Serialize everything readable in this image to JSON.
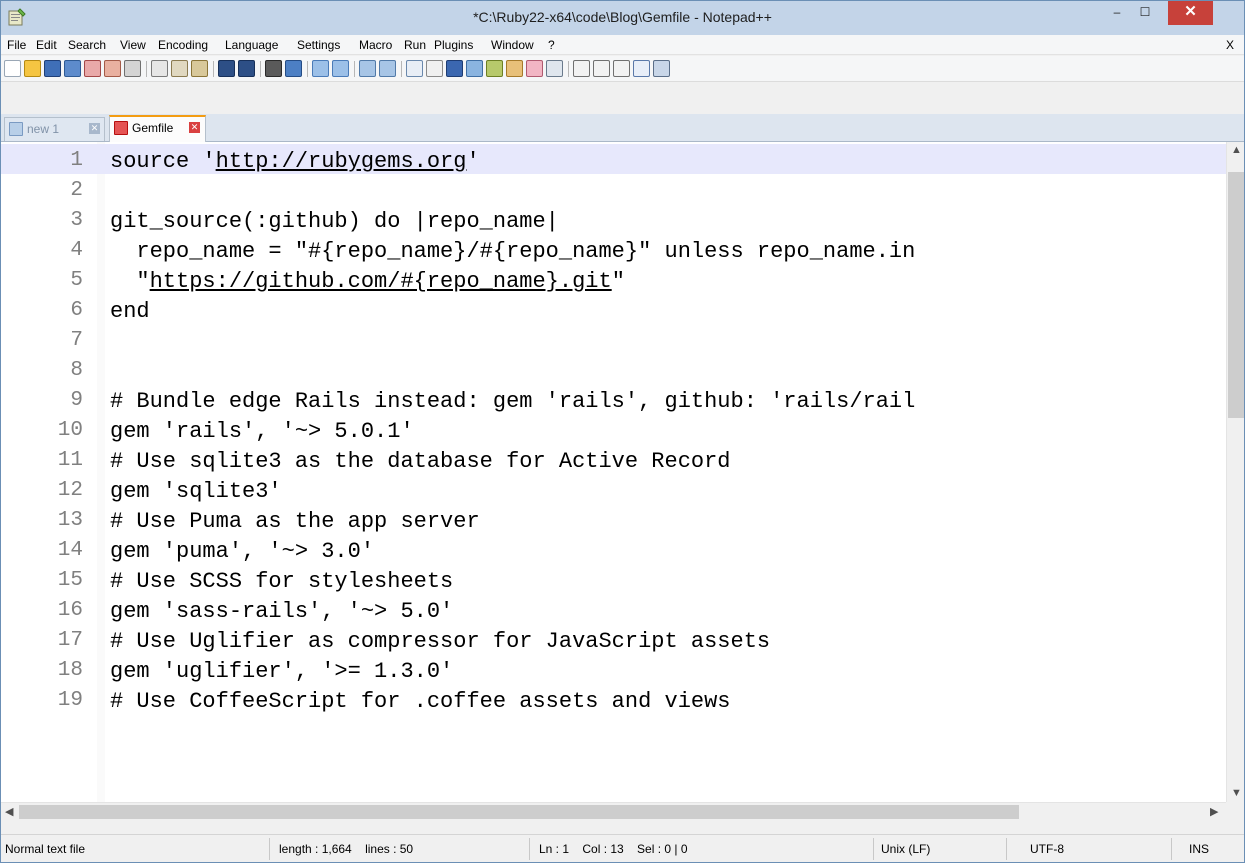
{
  "window": {
    "title": "*C:\\Ruby22-x64\\code\\Blog\\Gemfile - Notepad++",
    "minimize_label": "–",
    "maximize_label": "☐",
    "close_label": "✕"
  },
  "menu": {
    "items": [
      "File",
      "Edit",
      "Search",
      "View",
      "Encoding",
      "Language",
      "Settings",
      "Macro",
      "Run",
      "Plugins",
      "Window",
      "?"
    ],
    "close_label": "X"
  },
  "tabs": [
    {
      "label": "new 1",
      "active": false
    },
    {
      "label": "Gemfile",
      "active": true
    }
  ],
  "editor": {
    "lines": [
      {
        "n": "1",
        "parts": [
          [
            "text",
            "source '"
          ],
          [
            "link",
            "http://rubygems.org"
          ],
          [
            "text",
            "'"
          ]
        ]
      },
      {
        "n": "2",
        "parts": [
          [
            "text",
            ""
          ]
        ]
      },
      {
        "n": "3",
        "parts": [
          [
            "text",
            "git_source(:github) do |repo_name|"
          ]
        ]
      },
      {
        "n": "4",
        "parts": [
          [
            "text",
            "  repo_name = \"#{repo_name}/#{repo_name}\" unless repo_name.in"
          ]
        ]
      },
      {
        "n": "5",
        "parts": [
          [
            "text",
            "  \""
          ],
          [
            "link",
            "https://github.com/#{repo_name}.git"
          ],
          [
            "text",
            "\""
          ]
        ]
      },
      {
        "n": "6",
        "parts": [
          [
            "text",
            "end"
          ]
        ]
      },
      {
        "n": "7",
        "parts": [
          [
            "text",
            ""
          ]
        ]
      },
      {
        "n": "8",
        "parts": [
          [
            "text",
            ""
          ]
        ]
      },
      {
        "n": "9",
        "parts": [
          [
            "text",
            "# Bundle edge Rails instead: gem 'rails', github: 'rails/rail"
          ]
        ]
      },
      {
        "n": "10",
        "parts": [
          [
            "text",
            "gem 'rails', '~> 5.0.1'"
          ]
        ]
      },
      {
        "n": "11",
        "parts": [
          [
            "text",
            "# Use sqlite3 as the database for Active Record"
          ]
        ]
      },
      {
        "n": "12",
        "parts": [
          [
            "text",
            "gem 'sqlite3'"
          ]
        ]
      },
      {
        "n": "13",
        "parts": [
          [
            "text",
            "# Use Puma as the app server"
          ]
        ]
      },
      {
        "n": "14",
        "parts": [
          [
            "text",
            "gem 'puma', '~> 3.0'"
          ]
        ]
      },
      {
        "n": "15",
        "parts": [
          [
            "text",
            "# Use SCSS for stylesheets"
          ]
        ]
      },
      {
        "n": "16",
        "parts": [
          [
            "text",
            "gem 'sass-rails', '~> 5.0'"
          ]
        ]
      },
      {
        "n": "17",
        "parts": [
          [
            "text",
            "# Use Uglifier as compressor for JavaScript assets"
          ]
        ]
      },
      {
        "n": "18",
        "parts": [
          [
            "text",
            "gem 'uglifier', '>= 1.3.0'"
          ]
        ]
      },
      {
        "n": "19",
        "parts": [
          [
            "text",
            "# Use CoffeeScript for .coffee assets and views"
          ]
        ]
      }
    ],
    "current_line": 1
  },
  "status": {
    "file_type": "Normal text file",
    "length_lines": "length : 1,664    lines : 50",
    "position": "Ln : 1    Col : 13    Sel : 0 | 0",
    "eol": "Unix (LF)",
    "encoding": "UTF-8",
    "mode": "INS"
  },
  "colors": {
    "title_bar": "#c3d4e8",
    "close_button": "#c7413a",
    "current_line": "#e7e8fc",
    "line_number": "#808080",
    "active_tab_accent": "#f39c12"
  },
  "toolbar_icons": [
    "new-file-icon",
    "open-file-icon",
    "save-icon",
    "save-all-icon",
    "close-icon",
    "close-all-icon",
    "print-icon",
    "cut-icon",
    "copy-icon",
    "paste-icon",
    "undo-icon",
    "redo-icon",
    "find-icon",
    "replace-icon",
    "zoom-in-icon",
    "zoom-out-icon",
    "sync-vertical-icon",
    "sync-horizontal-icon",
    "word-wrap-icon",
    "show-all-chars-icon",
    "indent-guide-icon",
    "document-map-icon",
    "function-list-icon",
    "folder-workspace-icon",
    "doc-list-icon",
    "monitor-icon",
    "record-macro-icon",
    "stop-macro-icon",
    "play-macro-icon",
    "run-macro-multiple-icon",
    "save-macro-icon"
  ]
}
